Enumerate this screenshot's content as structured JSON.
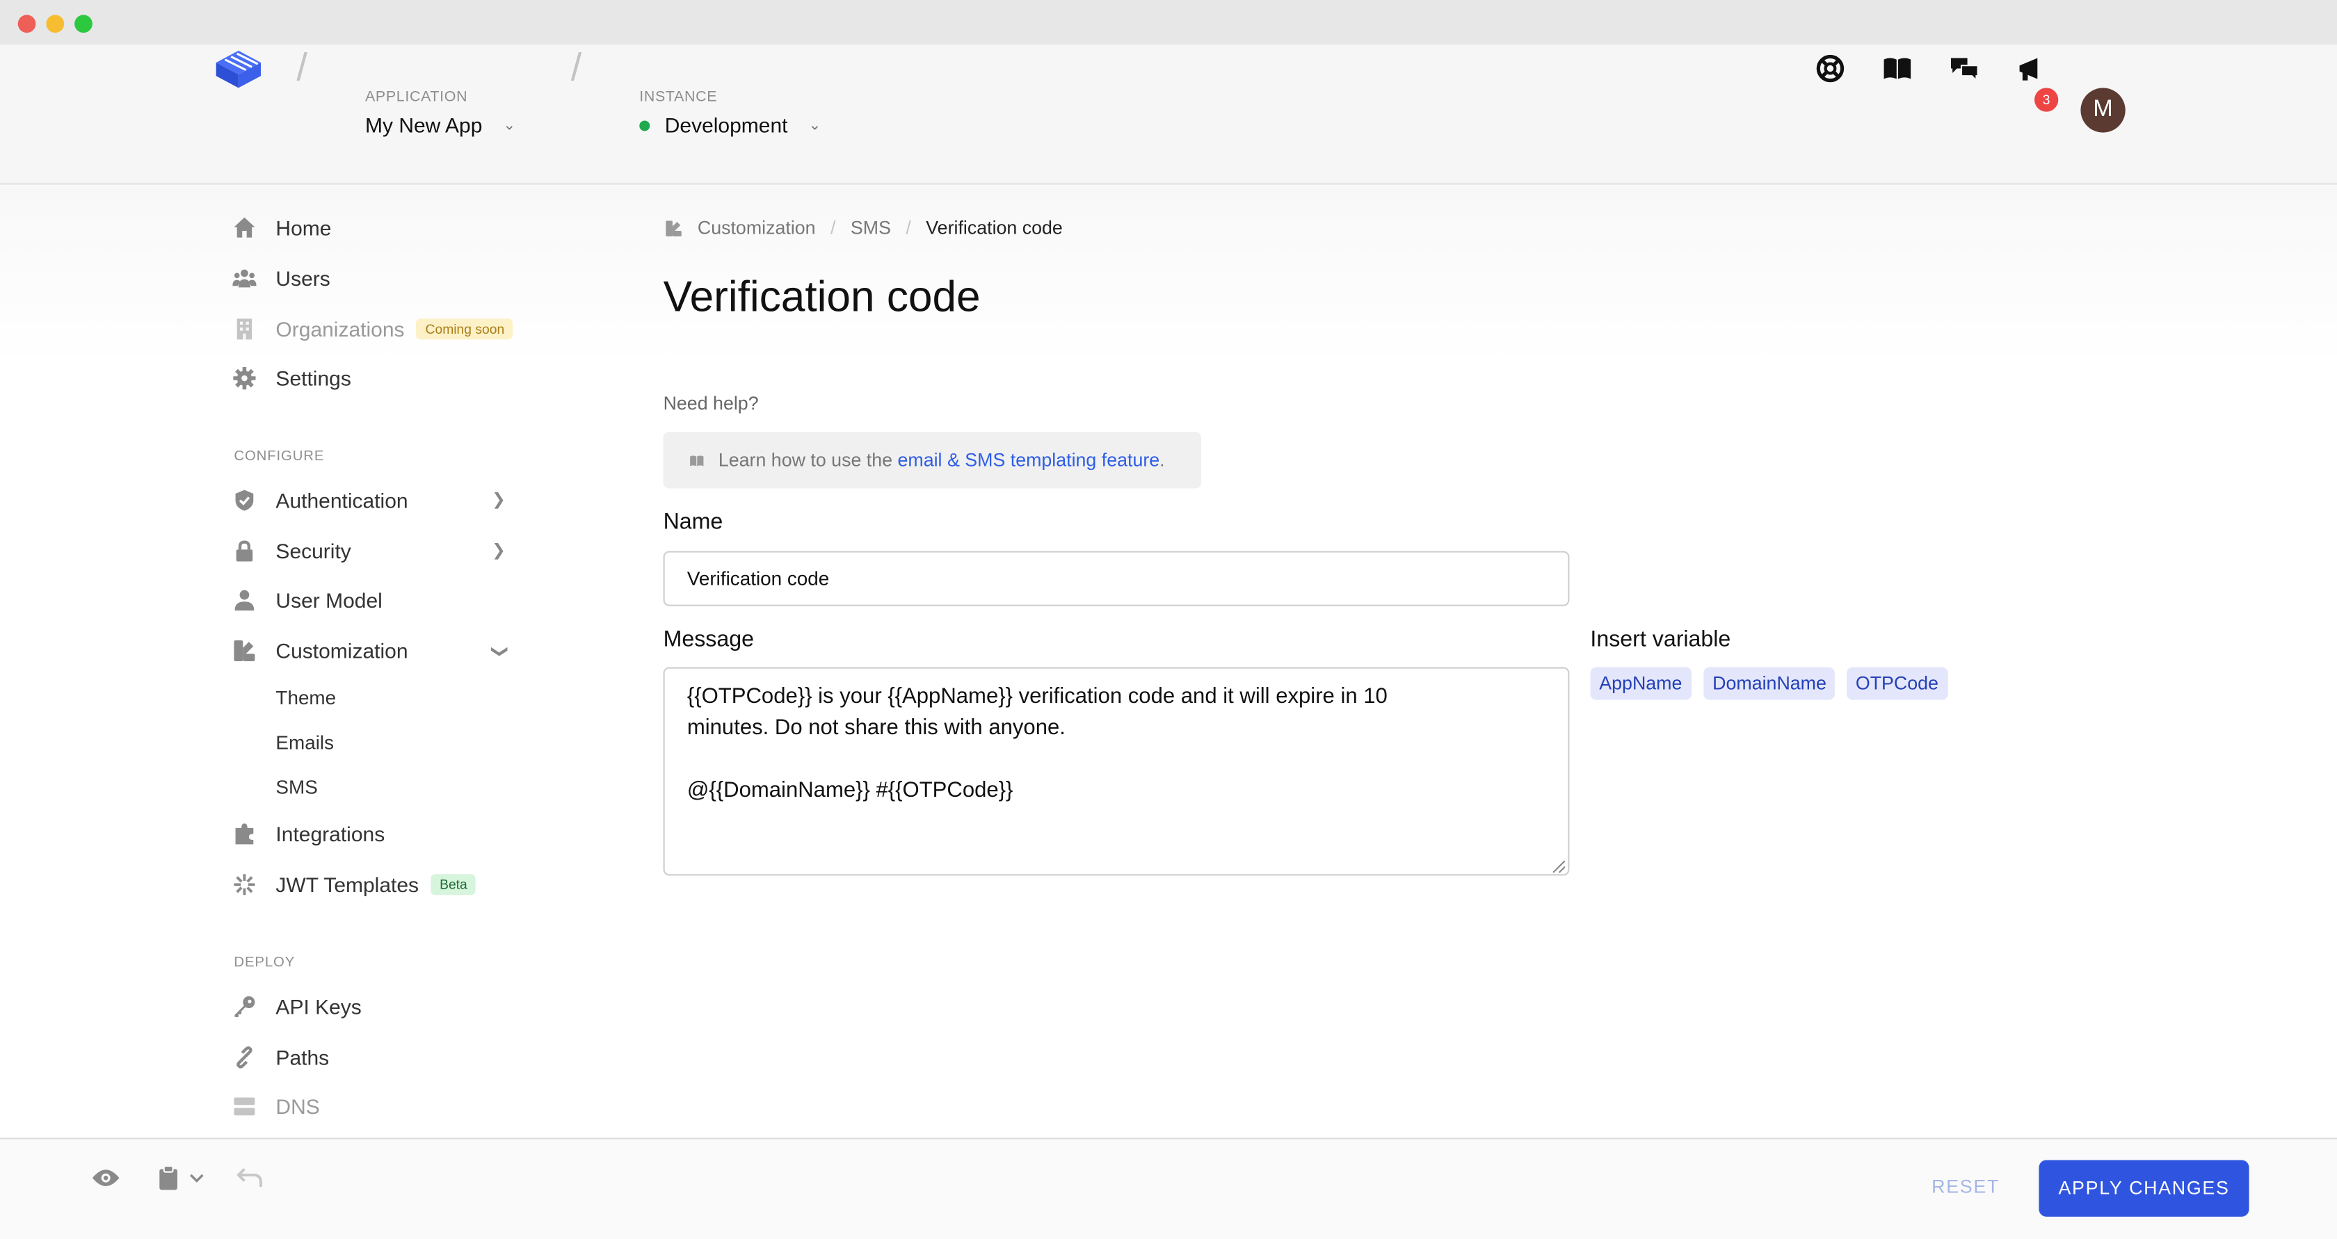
{
  "header": {
    "application_label": "APPLICATION",
    "application_value": "My New App",
    "instance_label": "INSTANCE",
    "instance_value": "Development",
    "notification_count": "3",
    "avatar_initial": "M"
  },
  "sidebar": {
    "items": [
      {
        "label": "Home"
      },
      {
        "label": "Users"
      },
      {
        "label": "Organizations",
        "badge": "Coming soon"
      },
      {
        "label": "Settings"
      }
    ],
    "configure_heading": "CONFIGURE",
    "configure_items": [
      {
        "label": "Authentication"
      },
      {
        "label": "Security"
      },
      {
        "label": "User Model"
      },
      {
        "label": "Customization"
      }
    ],
    "customization_sub": [
      {
        "label": "Theme"
      },
      {
        "label": "Emails"
      },
      {
        "label": "SMS"
      }
    ],
    "more_items": [
      {
        "label": "Integrations"
      },
      {
        "label": "JWT Templates",
        "badge": "Beta"
      }
    ],
    "deploy_heading": "DEPLOY",
    "deploy_items": [
      {
        "label": "API Keys"
      },
      {
        "label": "Paths"
      },
      {
        "label": "DNS"
      }
    ]
  },
  "breadcrumb": [
    "Customization",
    "SMS",
    "Verification code"
  ],
  "page": {
    "title": "Verification code",
    "help_label": "Need help?",
    "help_text": "Learn how to use the ",
    "help_link": "email & SMS templating feature",
    "help_suffix": "."
  },
  "form": {
    "name_label": "Name",
    "name_value": "Verification code",
    "message_label": "Message",
    "message_value": "{{OTPCode}} is your {{AppName}} verification code and it will expire in 10\nminutes. Do not share this with anyone.\n\n@{{DomainName}} #{{OTPCode}}",
    "insert_variable_label": "Insert variable",
    "variables": [
      "AppName",
      "DomainName",
      "OTPCode"
    ]
  },
  "footer": {
    "reset_label": "RESET",
    "apply_label": "APPLY CHANGES"
  },
  "colors": {
    "accent": "#2f55e0",
    "status_green": "#21a94f",
    "badge_red": "#ef4444"
  }
}
